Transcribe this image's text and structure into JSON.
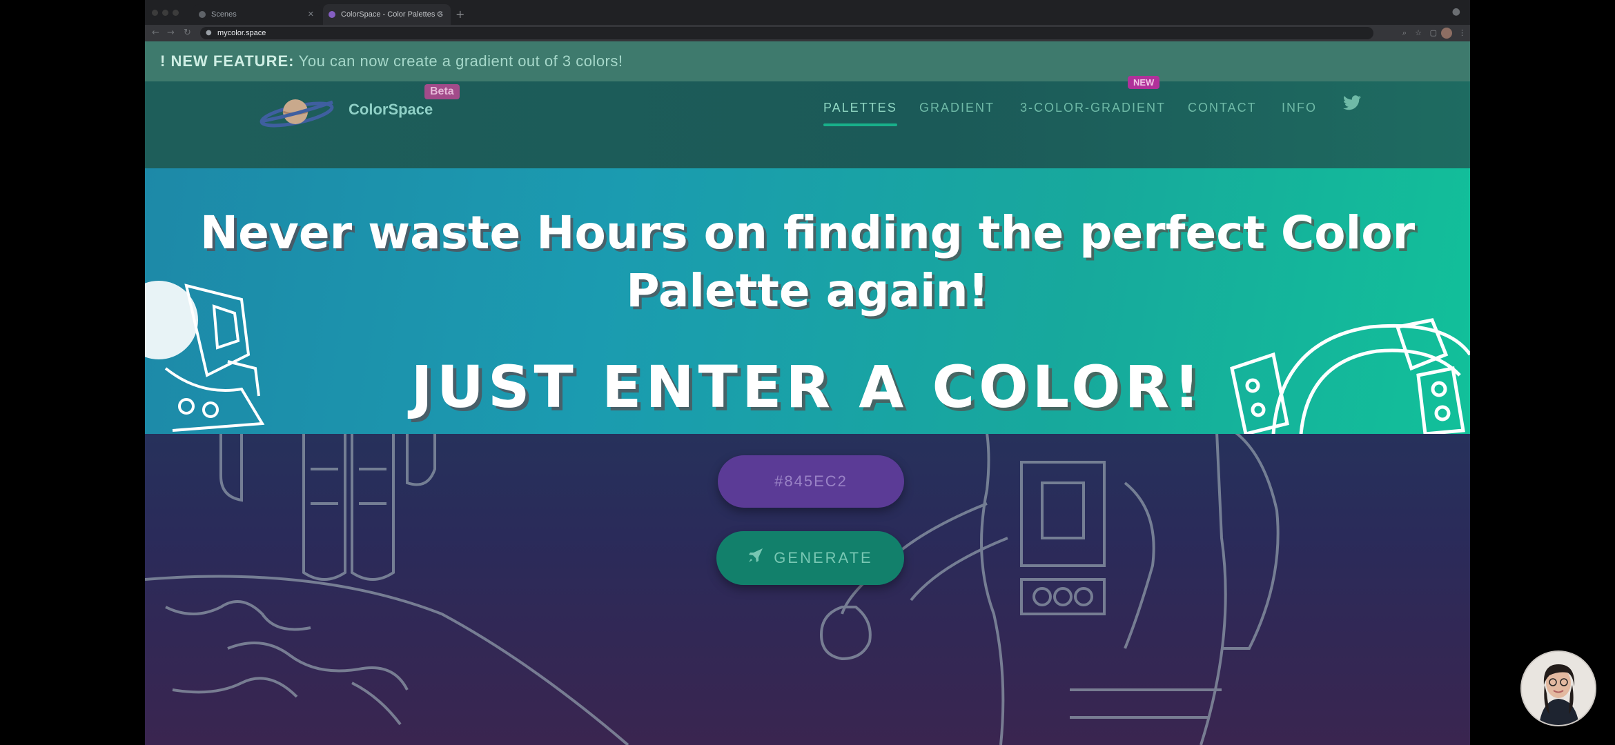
{
  "browser": {
    "tabs": [
      {
        "label": "Scenes"
      },
      {
        "label": "ColorSpace - Color Palettes G"
      }
    ],
    "url": "mycolor.space",
    "colors": {
      "chrome": "#202124",
      "toolbar": "#35363a"
    }
  },
  "announcement": {
    "bold": "! NEW FEATURE:",
    "text": " You can now create a gradient out of 3 colors!"
  },
  "brand": {
    "name": "ColorSpace",
    "badge": "Beta"
  },
  "nav": {
    "items": [
      {
        "label": "PALETTES",
        "active": true
      },
      {
        "label": "GRADIENT"
      },
      {
        "label": "3-COLOR-GRADIENT",
        "badge": "NEW"
      },
      {
        "label": "CONTACT"
      },
      {
        "label": "INFO"
      }
    ],
    "twitter_icon": "twitter-icon"
  },
  "hero": {
    "headline_line1": "Never waste Hours on finding the perfect Color",
    "headline_line2": "Palette again!",
    "cta": "JUST ENTER A COLOR!"
  },
  "form": {
    "color_value": "#845EC2",
    "generate_label": "GENERATE",
    "generate_icon": "rocket-icon"
  },
  "theme": {
    "accent": "#18b08a",
    "input_bg": "#5b3b96",
    "button_bg": "#12806b",
    "badge_pink": "#b0319a"
  }
}
